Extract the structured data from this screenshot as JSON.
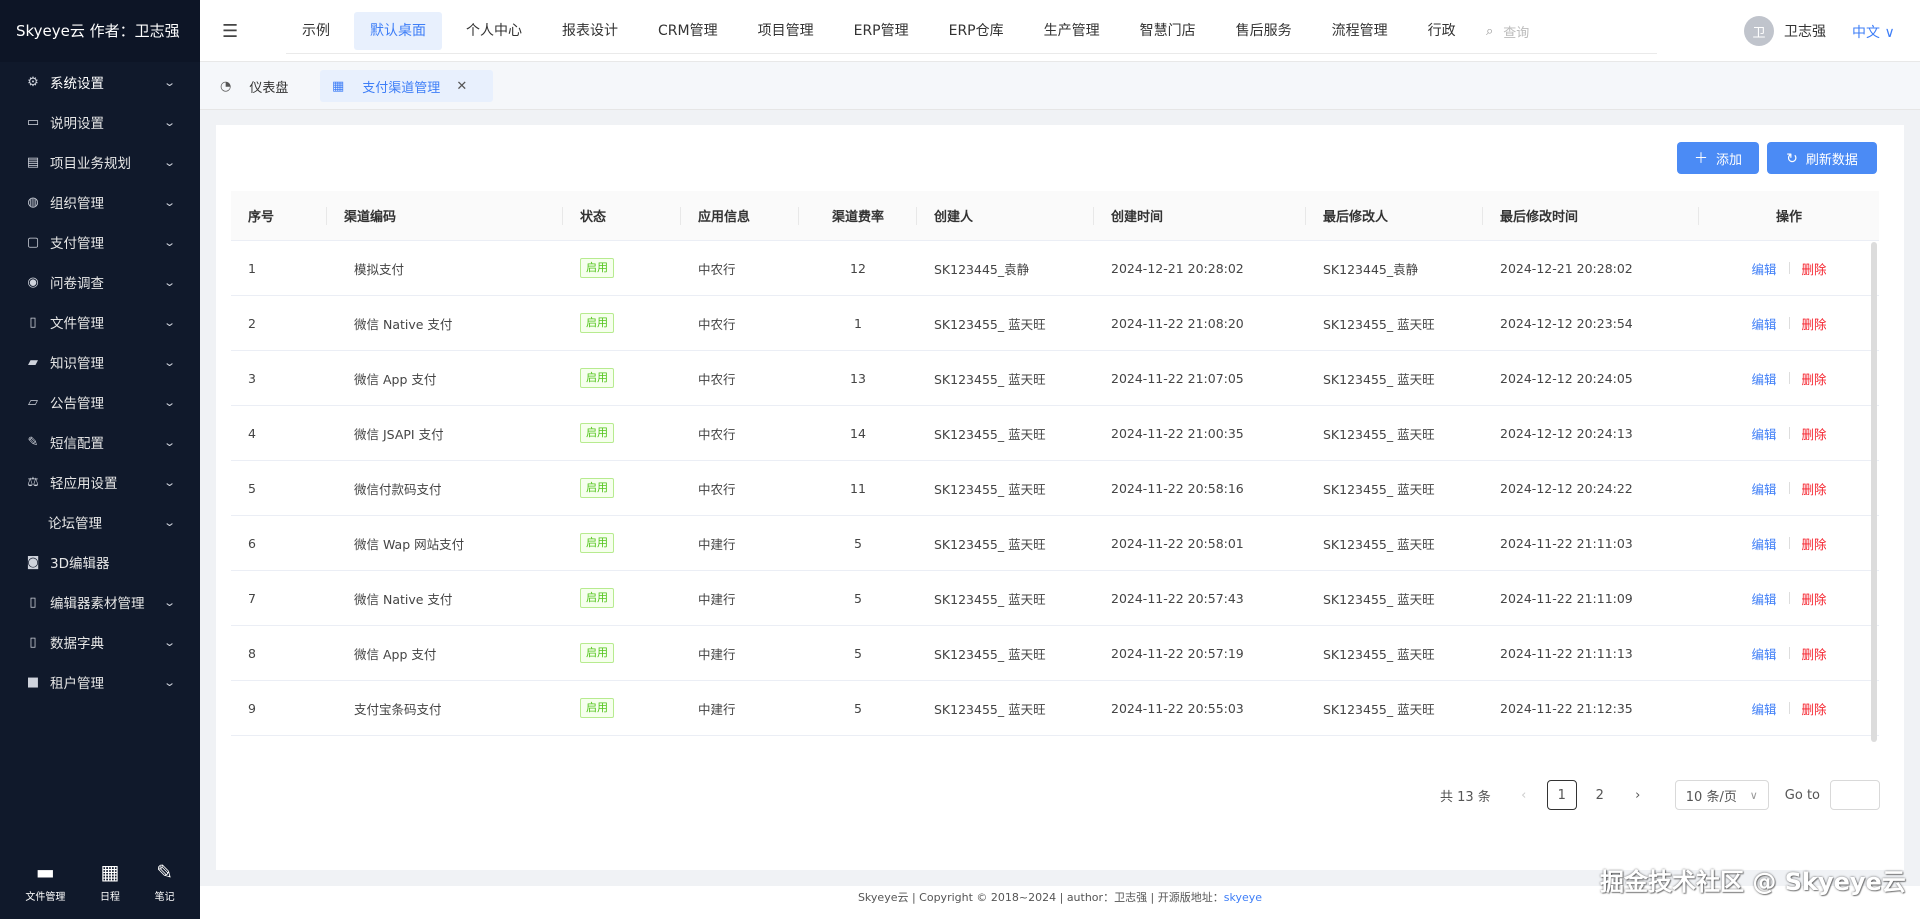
{
  "app": {
    "brand": "Skyeye云 作者：卫志强"
  },
  "sidebar": {
    "items": [
      {
        "label": "系统设置",
        "icon": "gear-icon",
        "glyph": "⚙"
      },
      {
        "label": "说明设置",
        "icon": "monitor-icon",
        "glyph": "▭"
      },
      {
        "label": "项目业务规划",
        "icon": "archive-icon",
        "glyph": "▤"
      },
      {
        "label": "组织管理",
        "icon": "dribbble-icon",
        "glyph": "◍"
      },
      {
        "label": "支付管理",
        "icon": "wallet-icon",
        "glyph": "▢"
      },
      {
        "label": "问卷调查",
        "icon": "chat-icon",
        "glyph": "◉"
      },
      {
        "label": "文件管理",
        "icon": "file-icon",
        "glyph": "▯"
      },
      {
        "label": "知识管理",
        "icon": "folder-open-icon",
        "glyph": "▰"
      },
      {
        "label": "公告管理",
        "icon": "folder-icon",
        "glyph": "▱"
      },
      {
        "label": "短信配置",
        "icon": "edit-icon",
        "glyph": "✎"
      },
      {
        "label": "轻应用设置",
        "icon": "balance-icon",
        "glyph": "⚖"
      },
      {
        "label": "论坛管理",
        "icon": "",
        "glyph": ""
      },
      {
        "label": "3D编辑器",
        "icon": "database-icon",
        "glyph": "◙"
      },
      {
        "label": "编辑器素材管理",
        "icon": "file-text-icon",
        "glyph": "▯"
      },
      {
        "label": "数据字典",
        "icon": "file-text-icon",
        "glyph": "▯"
      },
      {
        "label": "租户管理",
        "icon": "square-icon",
        "glyph": "■"
      }
    ],
    "footer": [
      {
        "label": "文件管理",
        "icon": "folder-icon",
        "glyph": "▬"
      },
      {
        "label": "日程",
        "icon": "calendar-icon",
        "glyph": "▦"
      },
      {
        "label": "笔记",
        "icon": "note-icon",
        "glyph": "✎"
      }
    ]
  },
  "topnav": {
    "items": [
      "示例",
      "默认桌面",
      "个人中心",
      "报表设计",
      "CRM管理",
      "项目管理",
      "ERP管理",
      "ERP仓库",
      "生产管理",
      "智慧门店",
      "售后服务",
      "流程管理",
      "行政"
    ],
    "active_index": 1,
    "search_placeholder": "查询",
    "user_avatar": "卫",
    "user_name": "卫志强",
    "language": "中文 ∨"
  },
  "tabs": {
    "dashboard": "仪表盘",
    "active": "支付渠道管理"
  },
  "toolbar": {
    "add_label": "添加",
    "refresh_label": "刷新数据"
  },
  "table": {
    "columns": [
      "序号",
      "渠道编码",
      "状态",
      "应用信息",
      "渠道费率",
      "创建人",
      "创建时间",
      "最后修改人",
      "最后修改时间",
      "操作"
    ],
    "rows": [
      {
        "no": "1",
        "code": "模拟支付",
        "status": "启用",
        "app": "中农行",
        "rate": "12",
        "creator": "SK123445_袁静",
        "created": "2024-12-21 20:28:02",
        "modifier": "SK123445_袁静",
        "modified": "2024-12-21 20:28:02"
      },
      {
        "no": "2",
        "code": "微信 Native 支付",
        "status": "启用",
        "app": "中农行",
        "rate": "1",
        "creator": "SK123455_ 蓝天旺",
        "created": "2024-11-22 21:08:20",
        "modifier": "SK123455_ 蓝天旺",
        "modified": "2024-12-12 20:23:54"
      },
      {
        "no": "3",
        "code": "微信 App 支付",
        "status": "启用",
        "app": "中农行",
        "rate": "13",
        "creator": "SK123455_ 蓝天旺",
        "created": "2024-11-22 21:07:05",
        "modifier": "SK123455_ 蓝天旺",
        "modified": "2024-12-12 20:24:05"
      },
      {
        "no": "4",
        "code": "微信 JSAPI 支付",
        "status": "启用",
        "app": "中农行",
        "rate": "14",
        "creator": "SK123455_ 蓝天旺",
        "created": "2024-11-22 21:00:35",
        "modifier": "SK123455_ 蓝天旺",
        "modified": "2024-12-12 20:24:13"
      },
      {
        "no": "5",
        "code": "微信付款码支付",
        "status": "启用",
        "app": "中农行",
        "rate": "11",
        "creator": "SK123455_ 蓝天旺",
        "created": "2024-11-22 20:58:16",
        "modifier": "SK123455_ 蓝天旺",
        "modified": "2024-12-12 20:24:22"
      },
      {
        "no": "6",
        "code": "微信 Wap 网站支付",
        "status": "启用",
        "app": "中建行",
        "rate": "5",
        "creator": "SK123455_ 蓝天旺",
        "created": "2024-11-22 20:58:01",
        "modifier": "SK123455_ 蓝天旺",
        "modified": "2024-11-22 21:11:03"
      },
      {
        "no": "7",
        "code": "微信 Native 支付",
        "status": "启用",
        "app": "中建行",
        "rate": "5",
        "creator": "SK123455_ 蓝天旺",
        "created": "2024-11-22 20:57:43",
        "modifier": "SK123455_ 蓝天旺",
        "modified": "2024-11-22 21:11:09"
      },
      {
        "no": "8",
        "code": "微信 App 支付",
        "status": "启用",
        "app": "中建行",
        "rate": "5",
        "creator": "SK123455_ 蓝天旺",
        "created": "2024-11-22 20:57:19",
        "modifier": "SK123455_ 蓝天旺",
        "modified": "2024-11-22 21:11:13"
      },
      {
        "no": "9",
        "code": "支付宝条码支付",
        "status": "启用",
        "app": "中建行",
        "rate": "5",
        "creator": "SK123455_ 蓝天旺",
        "created": "2024-11-22 20:55:03",
        "modifier": "SK123455_ 蓝天旺",
        "modified": "2024-11-22 21:12:35"
      }
    ],
    "actions": {
      "edit": "编辑",
      "delete": "删除"
    }
  },
  "pagination": {
    "total": "共 13 条",
    "pages": [
      "1",
      "2"
    ],
    "current": "1",
    "page_size": "10 条/页",
    "goto_label": "Go to"
  },
  "footer": {
    "text": "Skyeye云 | Copyright © 2018~2024 | author：卫志强 | 开源版地址：",
    "link": "skyeye"
  },
  "watermark": "掘金技术社区 @ Skyeye云",
  "colors": {
    "sidebar_bg": "#10192b",
    "accent": "#4b8bf5",
    "danger": "#f5222d",
    "success": "#52c41a"
  }
}
